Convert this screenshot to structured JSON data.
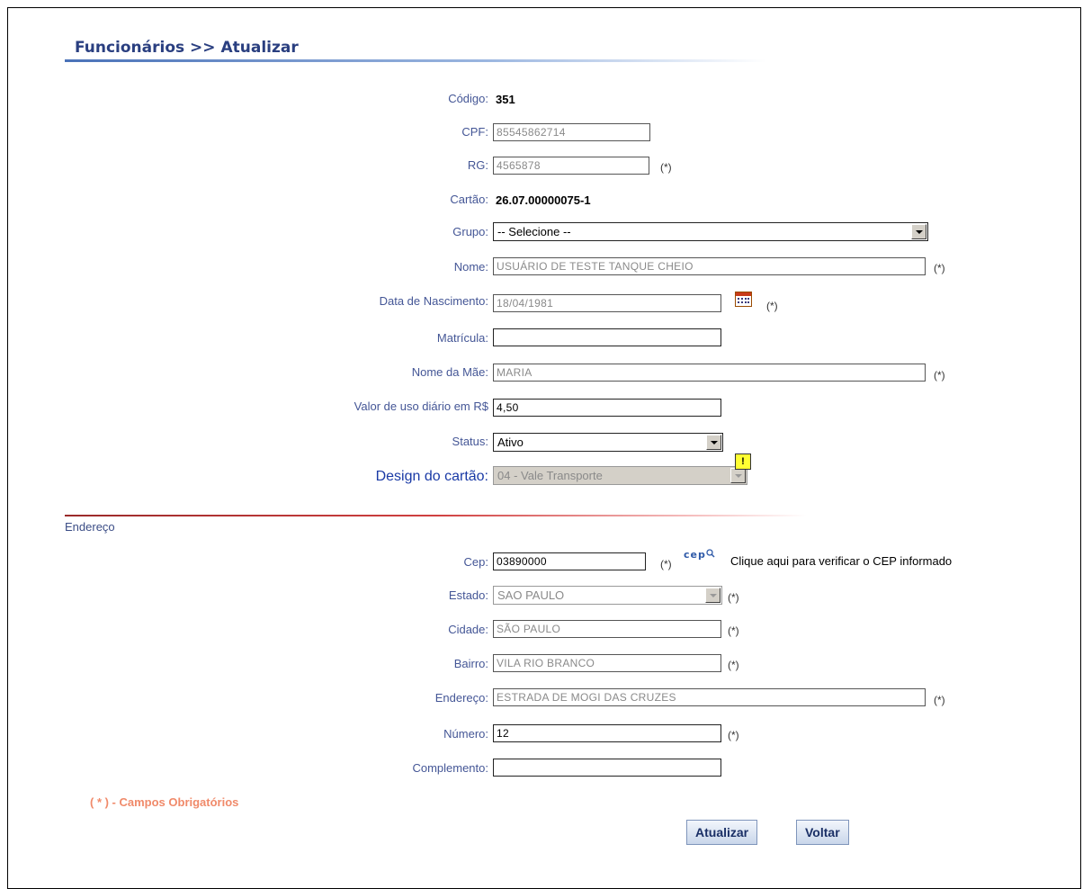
{
  "header": {
    "title": "Funcionários  >> Atualizar"
  },
  "fields": {
    "codigo": {
      "label": "Código:",
      "value": "351"
    },
    "cpf": {
      "label": "CPF:",
      "value": "85545862714"
    },
    "rg": {
      "label": "RG:",
      "value": "4565878",
      "req": "(*)"
    },
    "cartao": {
      "label": "Cartão:",
      "value": "26.07.00000075-1"
    },
    "grupo": {
      "label": "Grupo:",
      "value": "-- Selecione --"
    },
    "nome": {
      "label": "Nome:",
      "value": "USUÁRIO DE TESTE TANQUE CHEIO",
      "req": "(*)"
    },
    "nascimento": {
      "label": "Data de Nascimento:",
      "value": "18/04/1981",
      "req": "(*)"
    },
    "matricula": {
      "label": "Matrícula:",
      "value": ""
    },
    "mae": {
      "label": "Nome da Mãe:",
      "value": "MARIA",
      "req": "(*)"
    },
    "valor": {
      "label": "Valor de uso diário em R$",
      "value": "4,50"
    },
    "status": {
      "label": "Status:",
      "value": "Ativo"
    },
    "design": {
      "label": "Design do cartão:",
      "value": "04 - Vale Transporte",
      "badge": "!"
    }
  },
  "endereco_section": {
    "label": "Endereço"
  },
  "address": {
    "cep": {
      "label": "Cep:",
      "value": "03890000",
      "req": "(*)",
      "icon_text": "cep",
      "link": "Clique aqui para verificar o CEP informado"
    },
    "estado": {
      "label": "Estado:",
      "value": "SAO PAULO",
      "req": "(*)"
    },
    "cidade": {
      "label": "Cidade:",
      "value": "SÃO PAULO",
      "req": "(*)"
    },
    "bairro": {
      "label": "Bairro:",
      "value": "VILA RIO BRANCO",
      "req": "(*)"
    },
    "endereco": {
      "label": "Endereço:",
      "value": "ESTRADA DE MOGI DAS CRUZES",
      "req": "(*)"
    },
    "numero": {
      "label": "Número:",
      "value": "12",
      "req": "(*)"
    },
    "complemento": {
      "label": "Complemento:",
      "value": ""
    }
  },
  "footer": {
    "required_note": "( * ) - Campos Obrigatórios",
    "update_button": "Atualizar",
    "back_button": "Voltar"
  }
}
